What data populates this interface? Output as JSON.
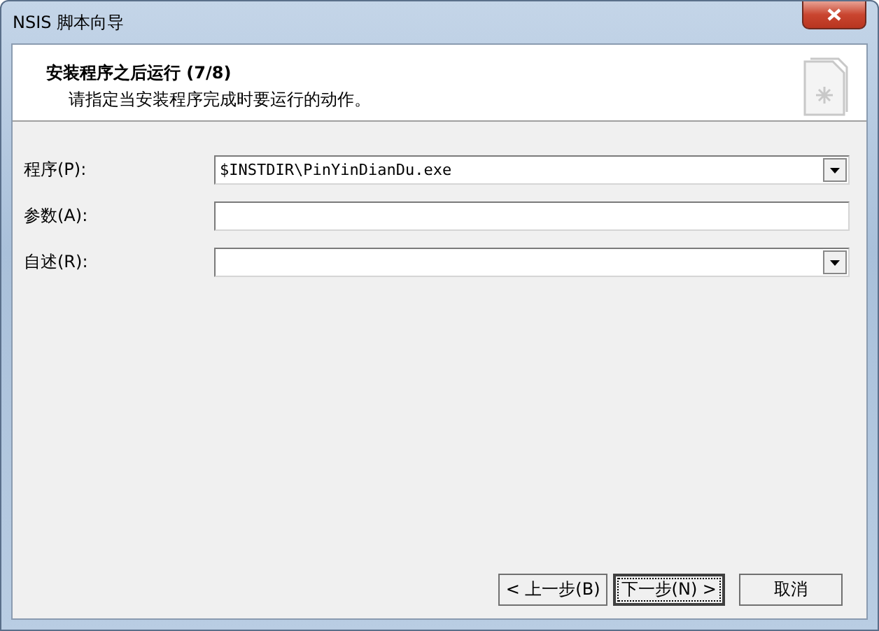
{
  "window": {
    "title": "NSIS 脚本向导"
  },
  "header": {
    "title": "安装程序之后运行 (7/8)",
    "subtitle": "请指定当安装程序完成时要运行的动作。"
  },
  "fields": [
    {
      "kind": "combo",
      "label": "程序(P):",
      "value": "$INSTDIR\\PinYinDianDu.exe"
    },
    {
      "kind": "text",
      "label": "参数(A):"
    },
    {
      "kind": "combo",
      "label": "自述(R):"
    }
  ],
  "buttons": [
    {
      "label": "< 上一步(B)",
      "default": false
    },
    {
      "label": "下一步(N) >",
      "default": true
    },
    {
      "label": "取消",
      "default": false
    }
  ]
}
